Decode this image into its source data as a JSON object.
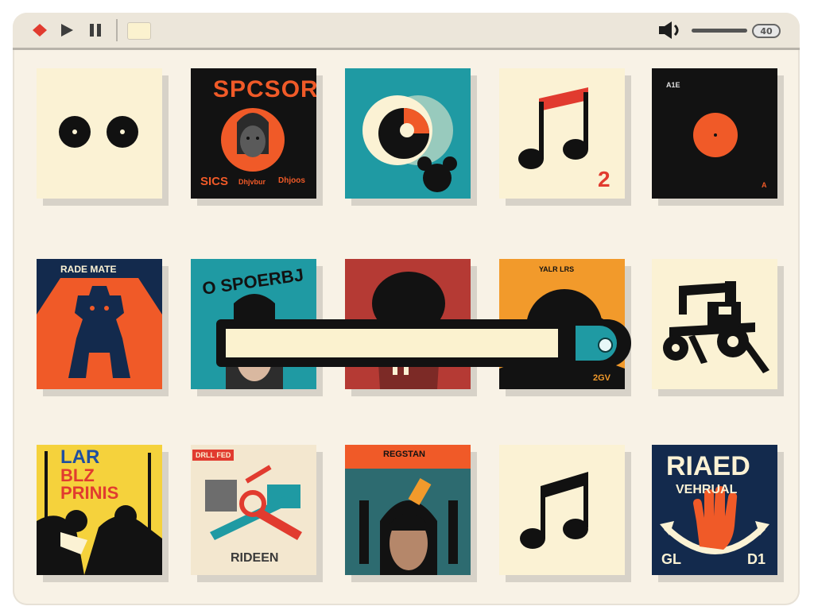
{
  "toolbar": {
    "record_icon": "diamond-record-icon",
    "play_icon": "play-icon",
    "pause_icon": "pause-icon",
    "volume_icon": "speaker-icon",
    "volume_badge": "40",
    "volume_level": 0.55
  },
  "albums": [
    {
      "title": "",
      "lines": []
    },
    {
      "title": "SPCSOR",
      "lines": [
        "SICS",
        "Dhjvbur",
        "Dhjoos"
      ]
    },
    {
      "title": "",
      "lines": []
    },
    {
      "title": "2",
      "lines": []
    },
    {
      "title": "A1E",
      "lines": [
        "A"
      ]
    },
    {
      "title": "RADE MATE",
      "lines": []
    },
    {
      "title": "O SPOERBJ",
      "lines": []
    },
    {
      "title": "",
      "lines": []
    },
    {
      "title": "YALR LRS",
      "lines": [
        "2GV"
      ]
    },
    {
      "title": "",
      "lines": []
    },
    {
      "title": "LAR",
      "lines": [
        "BLZ",
        "PRINIS"
      ]
    },
    {
      "title": "DRLL FED",
      "lines": [
        "RIDEEN"
      ]
    },
    {
      "title": "REGSTAN",
      "lines": []
    },
    {
      "title": "",
      "lines": []
    },
    {
      "title": "RIAED",
      "lines": [
        "VEHRUAL",
        "GL",
        "D1"
      ]
    }
  ],
  "search": {
    "value": "",
    "placeholder": "",
    "button_icon": "search-toggle-icon"
  },
  "colors": {
    "accent_orange": "#f05a28",
    "teal": "#1f9aa3",
    "navy": "#132a4d",
    "dark": "#121212",
    "cream": "#fbf2cf",
    "background": "#f8f2e6"
  }
}
